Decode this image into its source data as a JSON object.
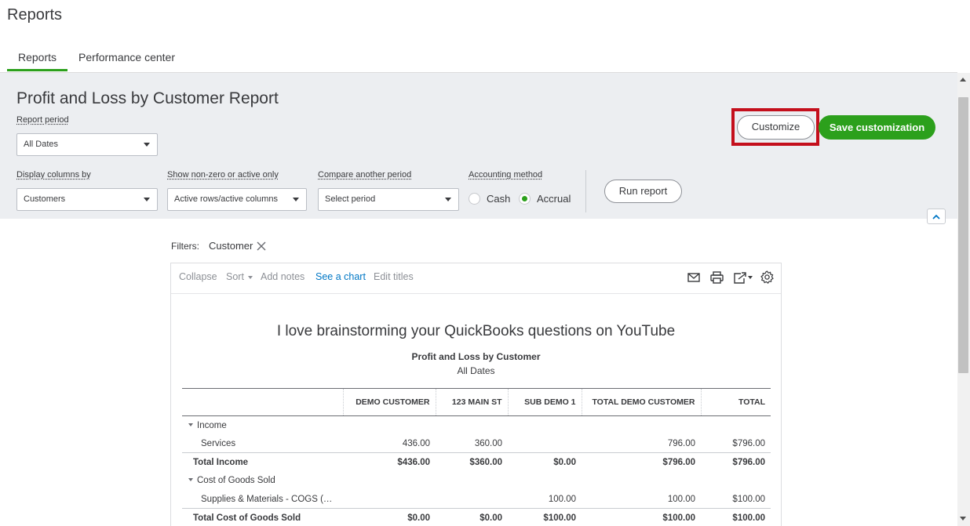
{
  "header": {
    "title": "Reports"
  },
  "tabs": [
    {
      "label": "Reports",
      "active": true
    },
    {
      "label": "Performance center",
      "active": false
    }
  ],
  "panel": {
    "report_title": "Profit and Loss by Customer Report",
    "report_period": {
      "label": "Report period",
      "value": "All Dates"
    },
    "display_columns": {
      "label": "Display columns by",
      "value": "Customers"
    },
    "non_zero": {
      "label": "Show non-zero or active only",
      "value": "Active rows/active columns"
    },
    "compare": {
      "label": "Compare another period",
      "placeholder": "Select period"
    },
    "accounting": {
      "label": "Accounting method",
      "options": [
        "Cash",
        "Accrual"
      ],
      "selected": "Accrual"
    },
    "run_report": "Run report",
    "customize": "Customize",
    "save_customization": "Save customization"
  },
  "filters": {
    "label": "Filters:",
    "chip": "Customer"
  },
  "toolbar": {
    "collapse": "Collapse",
    "sort": "Sort",
    "add_notes": "Add notes",
    "see_chart": "See a chart",
    "edit_titles": "Edit titles"
  },
  "report": {
    "company": "I love brainstorming your QuickBooks questions on YouTube",
    "name": "Profit and Loss by Customer",
    "dates": "All Dates",
    "columns": [
      "DEMO CUSTOMER",
      "123 MAIN ST",
      "SUB DEMO 1",
      "TOTAL DEMO CUSTOMER",
      "TOTAL"
    ],
    "rows": [
      {
        "label": "Income",
        "section": true,
        "values": [
          "",
          "",
          "",
          "",
          ""
        ]
      },
      {
        "label": "Services",
        "values": [
          "436.00",
          "360.00",
          "",
          "796.00",
          "$796.00"
        ]
      },
      {
        "label": "Total Income",
        "total": true,
        "values": [
          "$436.00",
          "$360.00",
          "$0.00",
          "$796.00",
          "$796.00"
        ]
      },
      {
        "label": "Cost of Goods Sold",
        "section": true,
        "values": [
          "",
          "",
          "",
          "",
          ""
        ]
      },
      {
        "label": "Supplies & Materials - COGS (…",
        "values": [
          "",
          "",
          "100.00",
          "100.00",
          "$100.00"
        ]
      },
      {
        "label": "Total Cost of Goods Sold",
        "total": true,
        "values": [
          "$0.00",
          "$0.00",
          "$100.00",
          "$100.00",
          "$100.00"
        ]
      }
    ]
  },
  "colors": {
    "accent_green": "#2ca01c",
    "highlight_red": "#c40f1c",
    "link_blue": "#0077c5",
    "panel_bg": "#eceef1"
  }
}
